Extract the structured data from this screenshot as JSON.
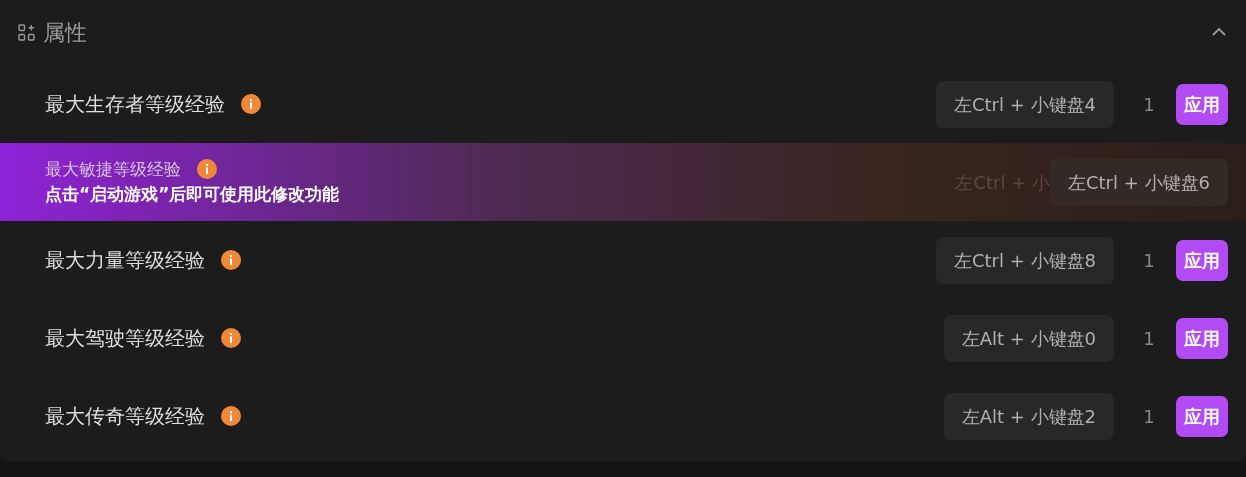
{
  "section": {
    "title": "属性",
    "expanded": true
  },
  "rows": [
    {
      "kind": "normal",
      "title": "最大生存者等级经验",
      "hotkey": "左Ctrl + 小键盘4",
      "value": "1",
      "button": "应用"
    },
    {
      "kind": "locked",
      "title": "最大敏捷等级经验",
      "message": "点击“启动游戏”后即可使用此修改功能",
      "hidden_hotkey": "左Ctrl + 小",
      "hotkey": "左Ctrl + 小键盘6"
    },
    {
      "kind": "normal",
      "title": "最大力量等级经验",
      "hotkey": "左Ctrl + 小键盘8",
      "value": "1",
      "button": "应用"
    },
    {
      "kind": "normal",
      "title": "最大驾驶等级经验",
      "hotkey": "左Alt + 小键盘0",
      "value": "1",
      "button": "应用"
    },
    {
      "kind": "normal",
      "title": "最大传奇等级经验",
      "hotkey": "左Alt + 小键盘2",
      "value": "1",
      "button": "应用"
    }
  ]
}
